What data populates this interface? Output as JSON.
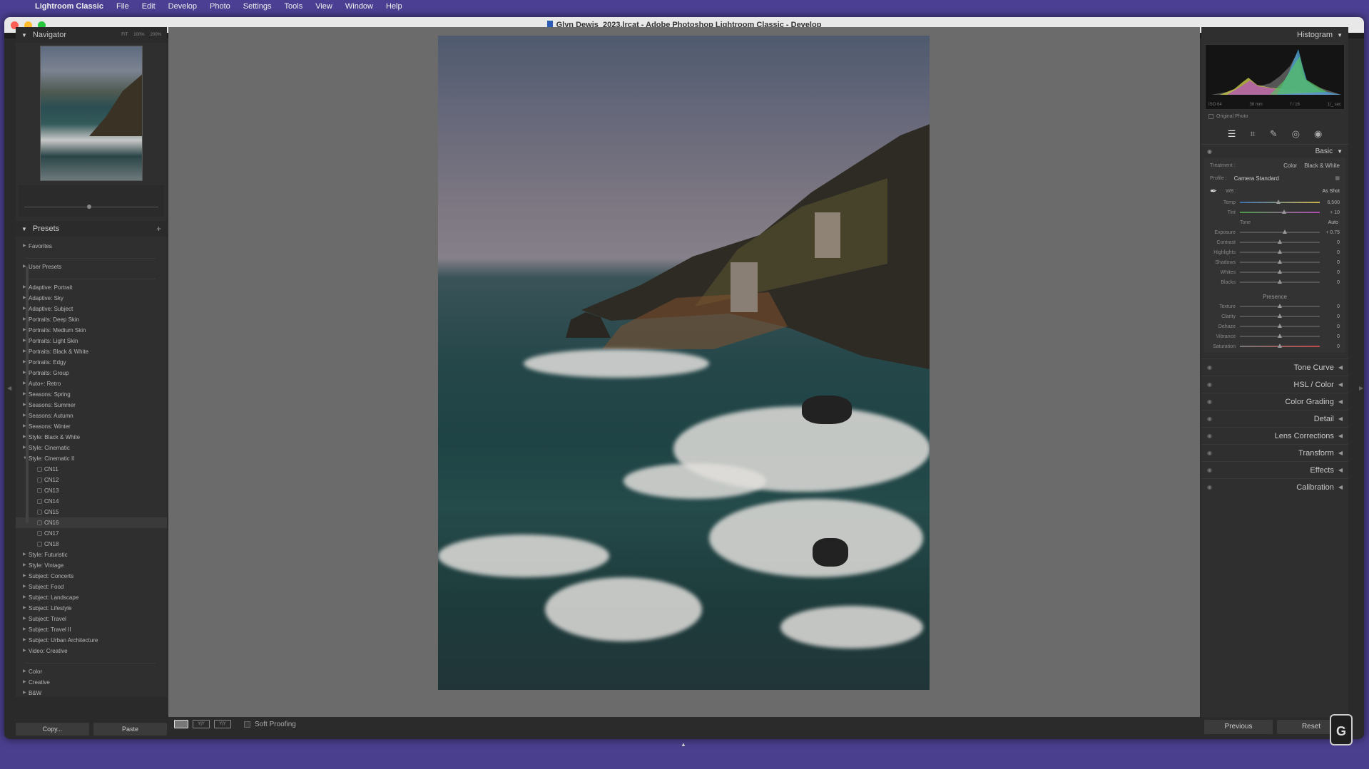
{
  "menubar": {
    "app_name": "Lightroom Classic",
    "items": [
      "File",
      "Edit",
      "Develop",
      "Photo",
      "Settings",
      "Tools",
      "View",
      "Window",
      "Help"
    ],
    "right_icons": [
      "more-icon",
      "display-icon",
      "clock-icon"
    ]
  },
  "window": {
    "title": "Glyn Dewis_2023.lrcat - Adobe Photoshop Lightroom Classic - Develop",
    "traffic_colors": [
      "#ff5f57",
      "#febc2e",
      "#28c840"
    ]
  },
  "navigator": {
    "title": "Navigator",
    "zoom_options": [
      "FIT",
      "100%",
      "200%"
    ]
  },
  "presets": {
    "title": "Presets",
    "groups_top": [
      "Favorites",
      "User Presets"
    ],
    "groups": [
      "Adaptive: Portrait",
      "Adaptive: Sky",
      "Adaptive: Subject",
      "Portraits: Deep Skin",
      "Portraits: Medium Skin",
      "Portraits: Light Skin",
      "Portraits: Black & White",
      "Portraits: Edgy",
      "Portraits: Group",
      "Auto+: Retro",
      "Seasons: Spring",
      "Seasons: Summer",
      "Seasons: Autumn",
      "Seasons: Winter",
      "Style: Black & White",
      "Style: Cinematic",
      "Style: Cinematic II"
    ],
    "cinematic_children": [
      "CN11",
      "CN12",
      "CN13",
      "CN14",
      "CN15",
      "CN16",
      "CN17",
      "CN18"
    ],
    "groups_after": [
      "Style: Futuristic",
      "Style: Vintage",
      "Subject: Concerts",
      "Subject: Food",
      "Subject: Landscape",
      "Subject: Lifestyle",
      "Subject: Travel",
      "Subject: Travel II",
      "Subject: Urban Architecture",
      "Video: Creative"
    ],
    "groups_bottom": [
      "Color",
      "Creative",
      "B&W"
    ]
  },
  "left_buttons": {
    "copy": "Copy...",
    "paste": "Paste"
  },
  "toolbar": {
    "soft_proofing": "Soft Proofing"
  },
  "histogram": {
    "title": "Histogram",
    "meta": [
      "ISO 64",
      "38 mm",
      "f / 16",
      "1/_ sec"
    ],
    "original_photo": "Original Photo"
  },
  "basic": {
    "title": "Basic",
    "treatment_label": "Treatment :",
    "treatment_options": [
      "Color",
      "Black & White"
    ],
    "profile_label": "Profile :",
    "profile_value": "Camera Standard",
    "wb_label": "WB :",
    "wb_value": "As Shot",
    "temp": {
      "label": "Temp",
      "value": "6,500",
      "pos": 0.48
    },
    "tint": {
      "label": "Tint",
      "value": "+ 10",
      "pos": 0.55
    },
    "tone_label": "Tone",
    "auto_label": "Auto",
    "tone_sliders": [
      {
        "label": "Exposure",
        "value": "+ 0.75",
        "pos": 0.56
      },
      {
        "label": "Contrast",
        "value": "0",
        "pos": 0.5
      },
      {
        "label": "Highlights",
        "value": "0",
        "pos": 0.5
      },
      {
        "label": "Shadows",
        "value": "0",
        "pos": 0.5
      },
      {
        "label": "Whites",
        "value": "0",
        "pos": 0.5
      },
      {
        "label": "Blacks",
        "value": "0",
        "pos": 0.5
      }
    ],
    "presence_label": "Presence",
    "presence_sliders": [
      {
        "label": "Texture",
        "value": "0",
        "pos": 0.5
      },
      {
        "label": "Clarity",
        "value": "0",
        "pos": 0.5
      },
      {
        "label": "Dehaze",
        "value": "0",
        "pos": 0.5
      },
      {
        "label": "Vibrance",
        "value": "0",
        "pos": 0.5
      },
      {
        "label": "Saturation",
        "value": "0",
        "pos": 0.5
      }
    ]
  },
  "collapsed_panels": [
    "Tone Curve",
    "HSL / Color",
    "Color Grading",
    "Detail",
    "Lens Corrections",
    "Transform",
    "Effects",
    "Calibration"
  ],
  "right_buttons": {
    "previous": "Previous",
    "reset": "Reset"
  }
}
